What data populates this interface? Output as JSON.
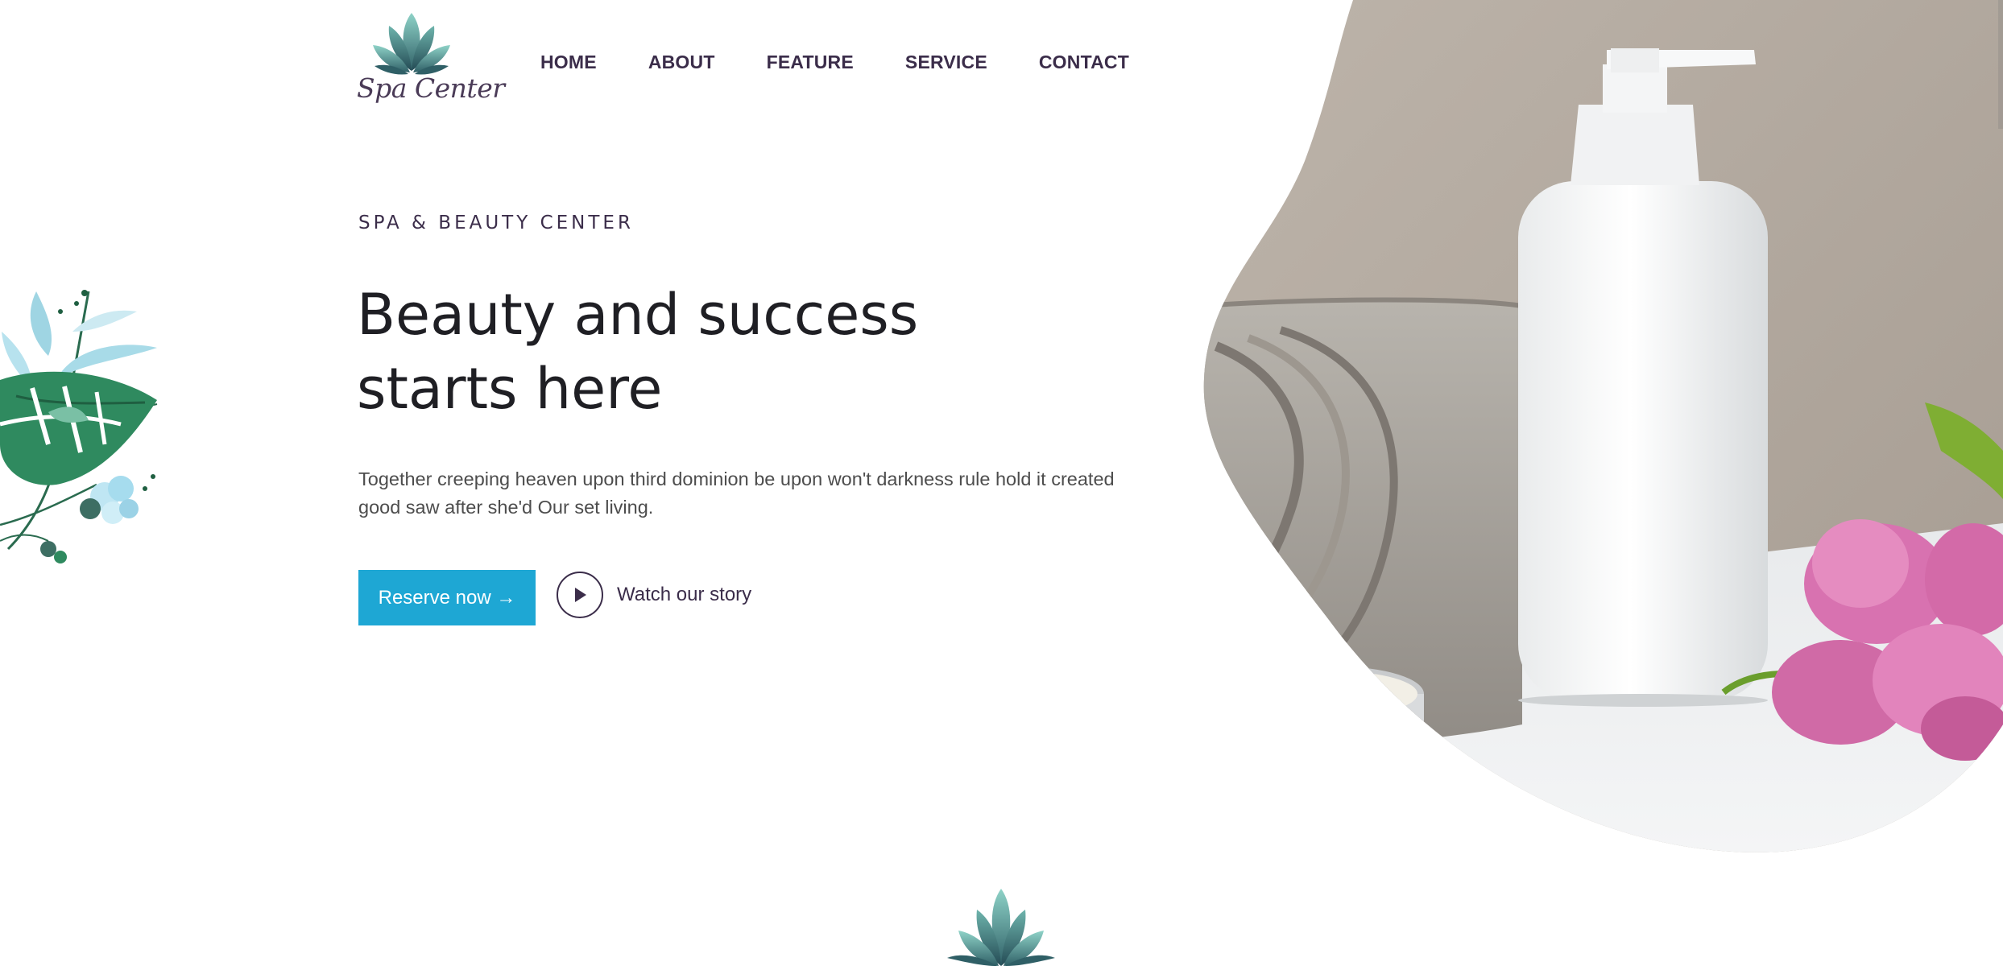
{
  "brand": {
    "name": "Spa Center"
  },
  "nav": {
    "items": [
      {
        "label": "HOME"
      },
      {
        "label": "ABOUT"
      },
      {
        "label": "FEATURE"
      },
      {
        "label": "SERVICE"
      },
      {
        "label": "CONTACT"
      }
    ]
  },
  "hero": {
    "eyebrow": "SPA & BEAUTY CENTER",
    "title": "Beauty and success starts here",
    "description": "Together creeping heaven upon third dominion be upon won't darkness rule hold it created good saw after she'd Our set living.",
    "reserve_label": "Reserve now →",
    "watch_label": "Watch our story"
  },
  "icons": {
    "logo": "lotus-logo-icon",
    "play": "play-icon",
    "leaf_decoration": "tropical-leaf-icon",
    "bottom_lotus": "lotus-icon"
  },
  "colors": {
    "accent": "#1ea7d4",
    "nav_text": "#3b2d4a",
    "title_text": "#1f1f24",
    "lotus_green": "#3d7d76"
  }
}
